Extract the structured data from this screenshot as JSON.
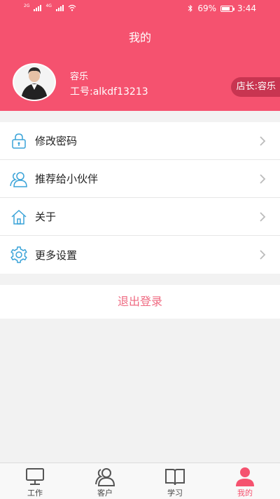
{
  "status_bar": {
    "signal_1": "2G",
    "signal_2": "4G",
    "battery": "69%",
    "time": "3:44"
  },
  "header": {
    "title": "我的"
  },
  "profile": {
    "name": "容乐",
    "id_label": "工号:alkdf13213",
    "store_badge": "店长:容乐"
  },
  "menu": {
    "items": [
      {
        "label": "修改密码",
        "icon": "lock-icon"
      },
      {
        "label": "推荐给小伙伴",
        "icon": "users-icon"
      },
      {
        "label": "关于",
        "icon": "home-icon"
      },
      {
        "label": "更多设置",
        "icon": "gear-icon"
      }
    ]
  },
  "logout": {
    "label": "退出登录"
  },
  "tabbar": {
    "tabs": [
      {
        "label": "工作",
        "icon": "monitor-icon"
      },
      {
        "label": "客户",
        "icon": "customers-icon"
      },
      {
        "label": "学习",
        "icon": "book-icon"
      },
      {
        "label": "我的",
        "icon": "person-icon"
      }
    ]
  },
  "colors": {
    "accent": "#f5526f",
    "badge": "#c83551",
    "logout_text": "#ef6b82",
    "icon_blue": "#3aa3d8"
  }
}
